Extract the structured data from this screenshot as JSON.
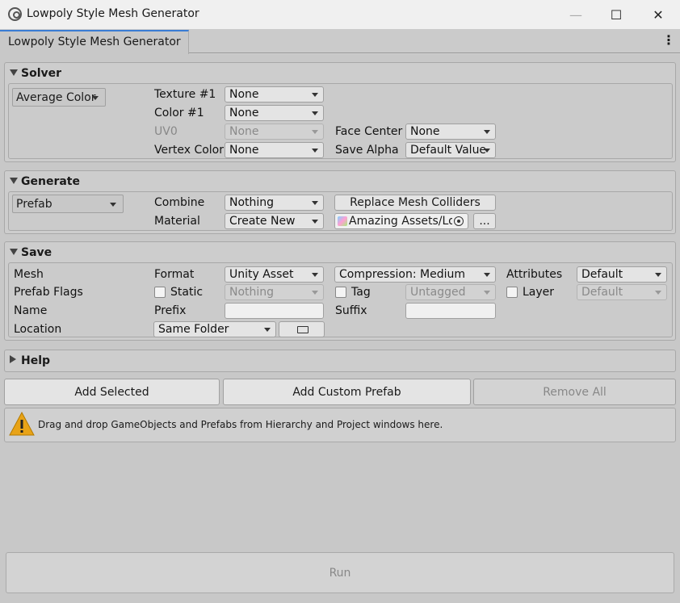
{
  "window": {
    "title": "Lowpoly Style Mesh Generator",
    "minimize": "—",
    "maximize": "☐",
    "close": "✕"
  },
  "tab": {
    "label": "Lowpoly Style Mesh Generator",
    "menu": "⋮"
  },
  "solver": {
    "title": "Solver",
    "mode": "Average Color",
    "texture_label": "Texture #1",
    "texture_value": "None",
    "color_label": "Color #1",
    "color_value": "None",
    "uv_label": "UV0",
    "uv_value": "None",
    "vertex_color_label": "Vertex Color",
    "vertex_color_value": "None",
    "face_center_label": "Face Center",
    "face_center_value": "None",
    "save_alpha_label": "Save Alpha",
    "save_alpha_value": "Default Value"
  },
  "generate": {
    "title": "Generate",
    "mode": "Prefab",
    "combine_label": "Combine",
    "combine_value": "Nothing",
    "material_label": "Material",
    "material_value": "Create New",
    "replace_colliders": "Replace Mesh Colliders",
    "asset_path": "Amazing Assets/Lo",
    "browse": "..."
  },
  "save": {
    "title": "Save",
    "mesh_label": "Mesh",
    "format_label": "Format",
    "format_value": "Unity Asset",
    "compression_value": "Compression:  Medium",
    "attributes_label": "Attributes",
    "attributes_value": "Default",
    "prefab_flags_label": "Prefab Flags",
    "static_label": "Static",
    "static_value": "Nothing",
    "tag_label": "Tag",
    "tag_value": "Untagged",
    "layer_label": "Layer",
    "layer_value": "Default",
    "name_label": "Name",
    "prefix_label": "Prefix",
    "prefix_value": "",
    "suffix_label": "Suffix",
    "suffix_value": "",
    "location_label": "Location",
    "location_value": "Same Folder"
  },
  "help": {
    "title": "Help"
  },
  "actions": {
    "add_selected": "Add Selected",
    "add_custom_prefab": "Add Custom Prefab",
    "remove_all": "Remove All"
  },
  "info": {
    "message": "Drag and drop GameObjects and Prefabs from Hierarchy and Project windows here."
  },
  "run": {
    "label": "Run"
  },
  "colors": {
    "accent": "#3a7cd4",
    "warning": "#e8a317"
  }
}
